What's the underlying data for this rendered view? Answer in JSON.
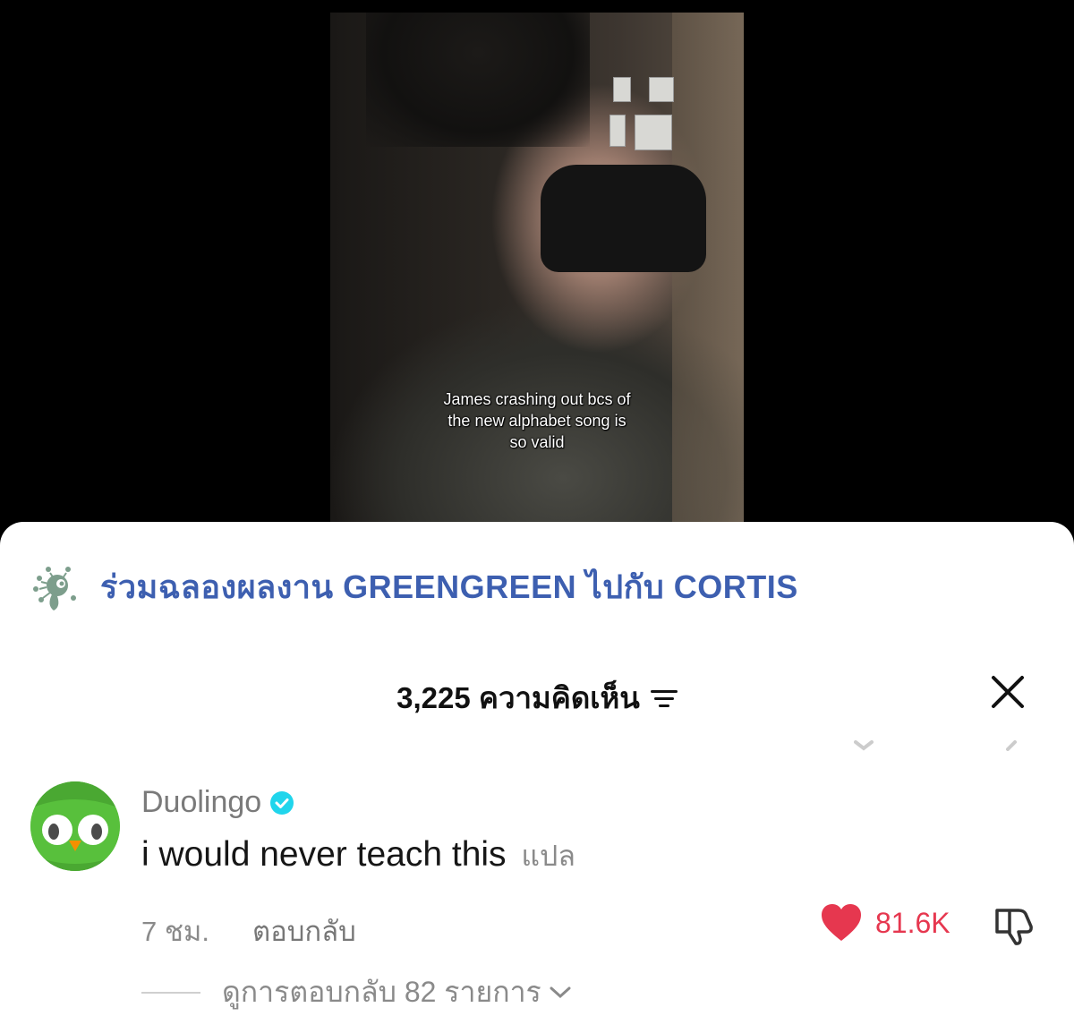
{
  "video": {
    "caption_line1": "James crashing out bcs of",
    "caption_line2": "the new alphabet song is",
    "caption_line3": "so valid"
  },
  "banner": {
    "text": "ร่วมฉลองผลงาน GREENGREEN ไปกับ CORTIS",
    "color": "#3d5fb0"
  },
  "comments_header": {
    "count_label": "3,225 ความคิดเห็น",
    "sort_icon": "sort-icon",
    "close_icon": "close-icon"
  },
  "comment": {
    "username": "Duolingo",
    "verified": true,
    "text": "i would never teach this",
    "translate_label": "แปล",
    "time": "7 ชม.",
    "reply_label": "ตอบกลับ",
    "likes": "81.6K",
    "liked": true,
    "like_color": "#e6374f",
    "view_replies_label": "ดูการตอบกลับ 82 รายการ"
  }
}
